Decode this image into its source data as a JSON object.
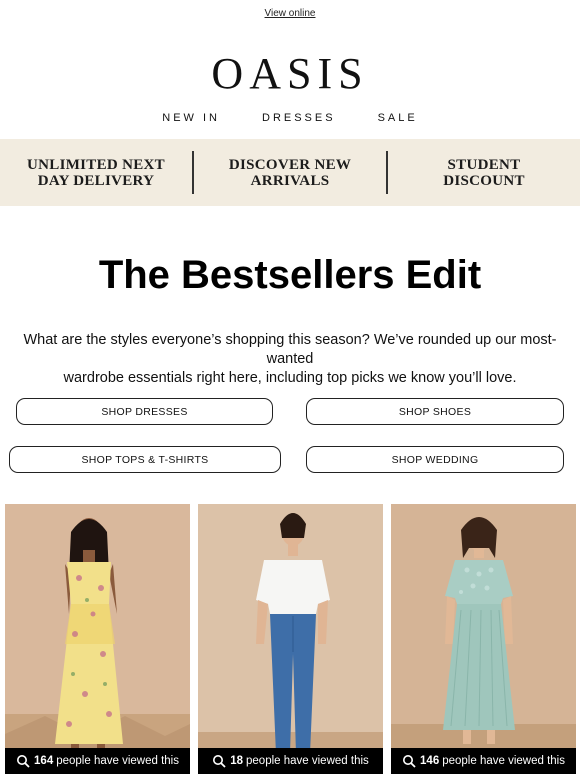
{
  "header": {
    "view_online": "View online",
    "logo": "OASIS",
    "nav": [
      "NEW IN",
      "DRESSES",
      "SALE"
    ]
  },
  "benefits": [
    {
      "line1": "UNLIMITED NEXT",
      "line2": "DAY DELIVERY"
    },
    {
      "line1": "DISCOVER NEW",
      "line2": "ARRIVALS"
    },
    {
      "line1": "STUDENT",
      "line2": "DISCOUNT"
    }
  ],
  "main": {
    "title": "The Bestsellers Edit",
    "intro_line1": "What are the styles everyone’s shopping this season? We’ve rounded up our most-wanted",
    "intro_line2": "wardrobe essentials right here, including top picks we know you’ll love."
  },
  "buttons": {
    "dresses": "SHOP DRESSES",
    "shoes": "SHOP SHOES",
    "tops": "SHOP TOPS & T-SHIRTS",
    "wedding": "SHOP WEDDING"
  },
  "products": [
    {
      "count": "164",
      "suffix": "people have viewed this",
      "bg": "#d9b89c"
    },
    {
      "count": "18",
      "suffix": "people have viewed this",
      "bg": "#dcc2a8"
    },
    {
      "count": "146",
      "suffix": "people have viewed this",
      "bg": "#d5b496"
    }
  ],
  "icons": {
    "view_count": "magnifier-icon"
  },
  "colors": {
    "benefit_bg": "#f2ece0",
    "view_bar": "#000000"
  }
}
